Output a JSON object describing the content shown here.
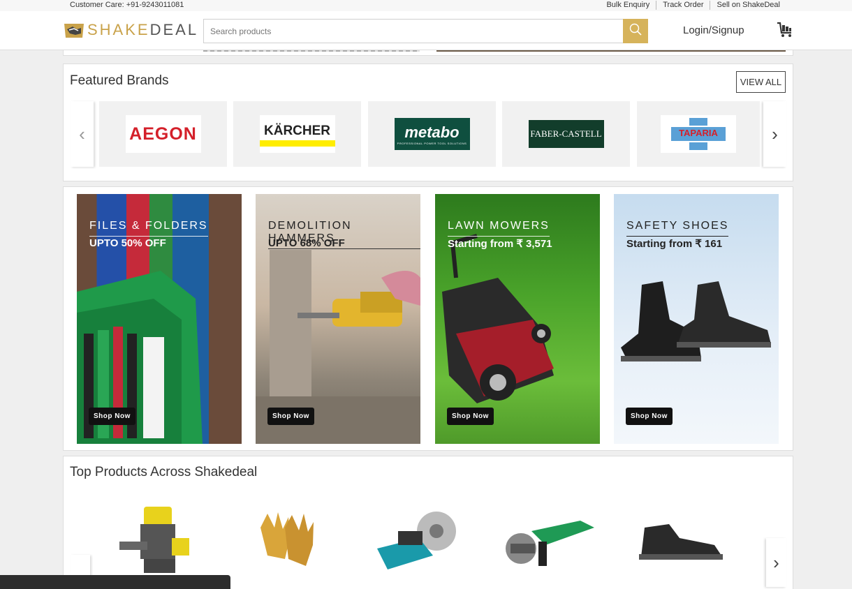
{
  "topbar": {
    "customer_care": "Customer Care: +91-9243011081",
    "links": [
      "Bulk Enquiry",
      "Track Order",
      "Sell on ShakeDeal"
    ]
  },
  "header": {
    "logo_a": "SHAKE",
    "logo_b": "DEAL",
    "search_placeholder": "Search products",
    "login": "Login/Signup",
    "icons": {
      "search": "search-icon",
      "cart": "cart-icon"
    }
  },
  "brands": {
    "title": "Featured Brands",
    "view_all": "VIEW ALL",
    "items": [
      {
        "name": "AEGON"
      },
      {
        "name": "KÄRCHER"
      },
      {
        "name": "metabo",
        "tagline": "PROFESSIONAL POWER TOOL SOLUTIONS"
      },
      {
        "name": "FABER-CASTELL"
      },
      {
        "name": "TAPARIA"
      }
    ]
  },
  "promos": [
    {
      "title": "FILES & FOLDERS",
      "offer": "UPTO 50% OFF",
      "cta": "Shop Now"
    },
    {
      "title": "DEMOLITION HAMMERS",
      "offer": "UPTO 68% OFF",
      "cta": "Shop Now"
    },
    {
      "title": "LAWN MOWERS",
      "offer": "Starting from ₹ 3,571",
      "cta": "Shop Now"
    },
    {
      "title": "SAFETY SHOES",
      "offer": "Starting from ₹ 161",
      "cta": "Shop Now"
    }
  ],
  "top_products": {
    "title": "Top Products Across Shakedeal"
  },
  "colors": {
    "brand_gold": "#d6b35b",
    "aegon_red": "#d4202a",
    "karcher_yellow": "#ffed00",
    "metabo_green": "#0f4f3f",
    "faber_green": "#123d2b",
    "taparia_blue": "#5aa0d6"
  }
}
